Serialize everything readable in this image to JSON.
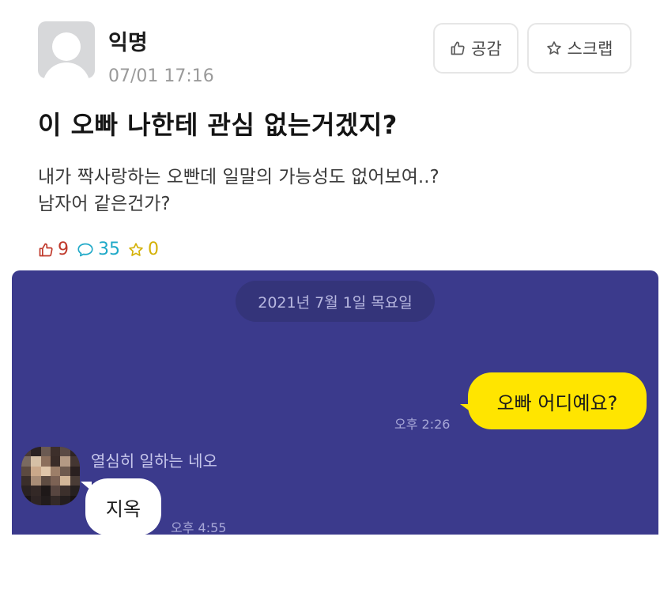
{
  "post": {
    "author": "익명",
    "timestamp": "07/01 17:16",
    "like_button_label": "공감",
    "scrap_button_label": "스크랩",
    "title": "이 오빠 나한테 관심 없는거겠지?",
    "content_line1": "내가 짝사랑하는 오빤데 일말의 가능성도 없어보여..?",
    "content_line2": "남자어 같은건가?",
    "stats": {
      "likes": "9",
      "comments": "35",
      "scraps": "0"
    },
    "colors": {
      "like": "#c0392b",
      "comment": "#1fa9c8",
      "scrap": "#d4b106"
    }
  },
  "chat": {
    "date": "2021년 7월 1일 목요일",
    "outgoing": {
      "text": "오빠 어디예요?",
      "time": "오후 2:26"
    },
    "incoming": {
      "sender": "열심히 일하는 네오",
      "text": "지옥",
      "time": "오후 4:55"
    },
    "colors": {
      "background": "#3b3a8c",
      "outgoing_bubble": "#ffe500",
      "incoming_bubble": "#ffffff"
    }
  }
}
